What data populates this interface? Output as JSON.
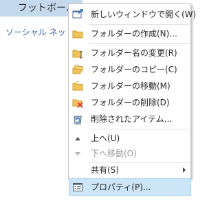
{
  "background": {
    "folder_title": "フットボール チーム",
    "link_text": "ソーシャル ネットワーク"
  },
  "menu": {
    "items": [
      {
        "label": "新しいウィンドウで開く(W)",
        "icon": "new-window-icon",
        "enabled": true
      },
      {
        "label": "フォルダーの作成(N)...",
        "icon": "folder-icon",
        "enabled": true
      },
      {
        "label": "フォルダー名の変更(R)",
        "icon": "rename-folder-icon",
        "enabled": true
      },
      {
        "label": "フォルダーのコピー(C)",
        "icon": "copy-folder-icon",
        "enabled": true
      },
      {
        "label": "フォルダーの移動(M)",
        "icon": "move-folder-icon",
        "enabled": true
      },
      {
        "label": "フォルダーの削除(D)",
        "icon": "delete-folder-icon",
        "enabled": true
      },
      {
        "label": "削除されたアイテム...",
        "icon": "recover-deleted-items-icon",
        "enabled": true
      },
      {
        "label": "上へ(U)",
        "icon": "arrow-up-icon",
        "enabled": true
      },
      {
        "label": "下へ移動(O)",
        "icon": "arrow-down-icon",
        "enabled": false
      },
      {
        "label": "共有(S)",
        "icon": "",
        "enabled": true,
        "submenu": true
      },
      {
        "label": "プロパティ(P)...",
        "icon": "properties-icon",
        "enabled": true,
        "highlighted": true
      }
    ]
  },
  "colors": {
    "highlight": "#cde6f7",
    "selection": "#c5d9ee",
    "folder": "#f0c35b",
    "delete": "#e23b2e"
  }
}
